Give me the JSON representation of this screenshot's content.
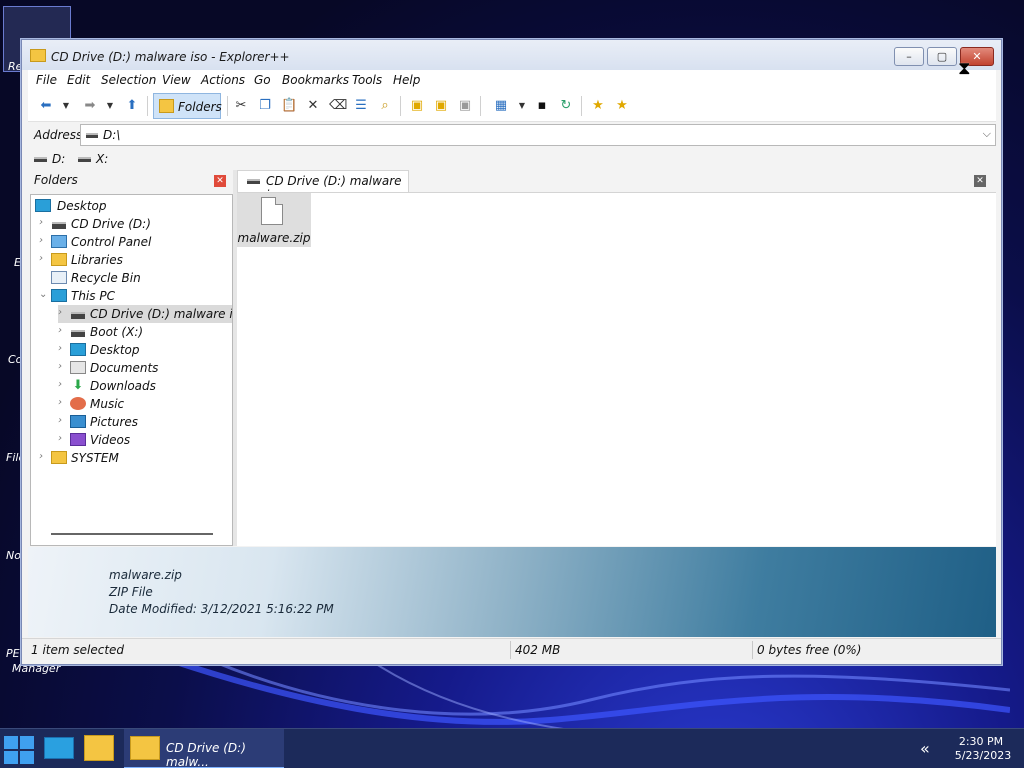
{
  "window": {
    "title": "CD Drive (D:) malware iso - Explorer++",
    "controls": {
      "minimize": "–",
      "maximize": "▢",
      "close": "✕"
    }
  },
  "menu": [
    "File",
    "Edit",
    "Selection",
    "View",
    "Actions",
    "Go",
    "Bookmarks",
    "Tools",
    "Help"
  ],
  "toolbar": {
    "folders_label": "Folders",
    "icons": [
      "back-icon",
      "forward-icon",
      "up-icon",
      "cut-icon",
      "copy-icon",
      "paste-icon",
      "delete-icon",
      "delete-permanently-icon",
      "properties-icon",
      "search-icon",
      "new-folder-icon",
      "copy-to-icon",
      "move-to-icon",
      "views-icon",
      "command-prompt-icon",
      "refresh-icon",
      "add-bookmark-icon",
      "bookmarks-icon"
    ]
  },
  "address": {
    "label": "Address",
    "value": "D:\\"
  },
  "drives": [
    "D:",
    "X:"
  ],
  "folders_pane": {
    "title": "Folders",
    "close": "✕",
    "tree": [
      {
        "label": "Desktop",
        "icon": "desktop-icon",
        "depth": 0
      },
      {
        "label": "CD Drive (D:)",
        "icon": "drive-icon",
        "depth": 1
      },
      {
        "label": "Control Panel",
        "icon": "control-panel-icon",
        "depth": 1
      },
      {
        "label": "Libraries",
        "icon": "folder-icon",
        "depth": 1
      },
      {
        "label": "Recycle Bin",
        "icon": "recycle-bin-icon",
        "depth": 1
      },
      {
        "label": "This PC",
        "icon": "computer-icon",
        "depth": 1
      },
      {
        "label": "CD Drive (D:) malware iso",
        "icon": "drive-icon",
        "depth": 2,
        "selected": true
      },
      {
        "label": "Boot (X:)",
        "icon": "drive-icon",
        "depth": 2
      },
      {
        "label": "Desktop",
        "icon": "desktop-icon",
        "depth": 2
      },
      {
        "label": "Documents",
        "icon": "documents-icon",
        "depth": 2
      },
      {
        "label": "Downloads",
        "icon": "downloads-icon",
        "depth": 2
      },
      {
        "label": "Music",
        "icon": "music-icon",
        "depth": 2
      },
      {
        "label": "Pictures",
        "icon": "pictures-icon",
        "depth": 2
      },
      {
        "label": "Videos",
        "icon": "videos-icon",
        "depth": 2
      },
      {
        "label": "SYSTEM",
        "icon": "folder-icon",
        "depth": 1
      }
    ]
  },
  "tab": {
    "label": "CD Drive (D:) malware iso",
    "close": "✕"
  },
  "files": [
    {
      "name": "malware.zip",
      "icon": "file-icon"
    }
  ],
  "details": {
    "name": "malware.zip",
    "type": "ZIP File",
    "modified": "Date Modified: 3/12/2021 5:16:22 PM"
  },
  "status": {
    "selection": "1 item selected",
    "size": "402 MB",
    "free": "0 bytes free (0%)"
  },
  "desktop": {
    "labels": [
      "Re",
      "E",
      "Co",
      "File",
      "No",
      "PE",
      "Manager"
    ]
  },
  "taskbar": {
    "active_window": "CD Drive (D:) malw...",
    "tray_arrow": "«",
    "time": "2:30 PM",
    "date": "5/23/2023"
  },
  "colors": {
    "accent": "#2a6fc0",
    "folder": "#f4c542",
    "close": "#c2432f"
  }
}
